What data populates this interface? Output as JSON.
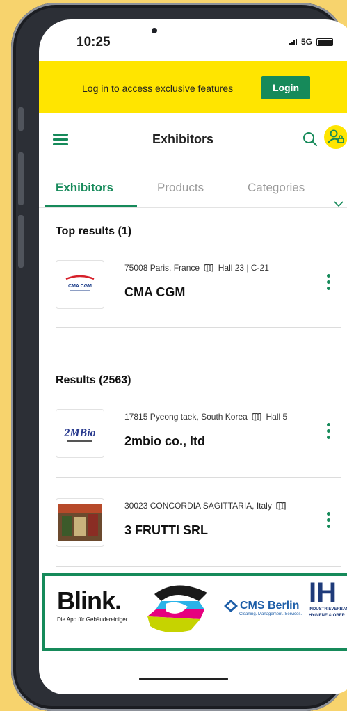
{
  "status_bar": {
    "time": "10:25",
    "network": "5G"
  },
  "banner": {
    "message": "Log in to access exclusive features",
    "login_label": "Login"
  },
  "header": {
    "title": "Exhibitors"
  },
  "tabs": [
    {
      "label": "Exhibitors",
      "active": true
    },
    {
      "label": "Products",
      "active": false
    },
    {
      "label": "Categories",
      "active": false
    }
  ],
  "top_results": {
    "title": "Top results (1)",
    "items": [
      {
        "location": "75008 Paris, France",
        "hall": "Hall 23 | C-21",
        "name": "CMA CGM",
        "logo_text": "CMA CGM"
      }
    ]
  },
  "results": {
    "title": "Results (2563)",
    "items": [
      {
        "location": "17815 Pyeong taek, South Korea",
        "hall": "Hall 5",
        "name": "2mbio co., ltd",
        "logo_text": "2MBio"
      },
      {
        "location": "30023 CONCORDIA SAGITTARIA, Italy",
        "hall": "",
        "name": "3 FRUTTI SRL",
        "logo_text": ""
      }
    ]
  },
  "sponsors": [
    {
      "name": "Blink.",
      "tagline": "Die App für Gebäudereiniger"
    },
    {
      "name": "",
      "tagline": ""
    },
    {
      "name": "CMS Berlin",
      "tagline": "Cleaning. Management. Services."
    },
    {
      "name": "IH",
      "tagline": "INDUSTRIEVERBAND HYGIENE & OBER"
    }
  ],
  "colors": {
    "accent": "#168a5a",
    "banner": "#ffe500",
    "background": "#f7d36d"
  }
}
